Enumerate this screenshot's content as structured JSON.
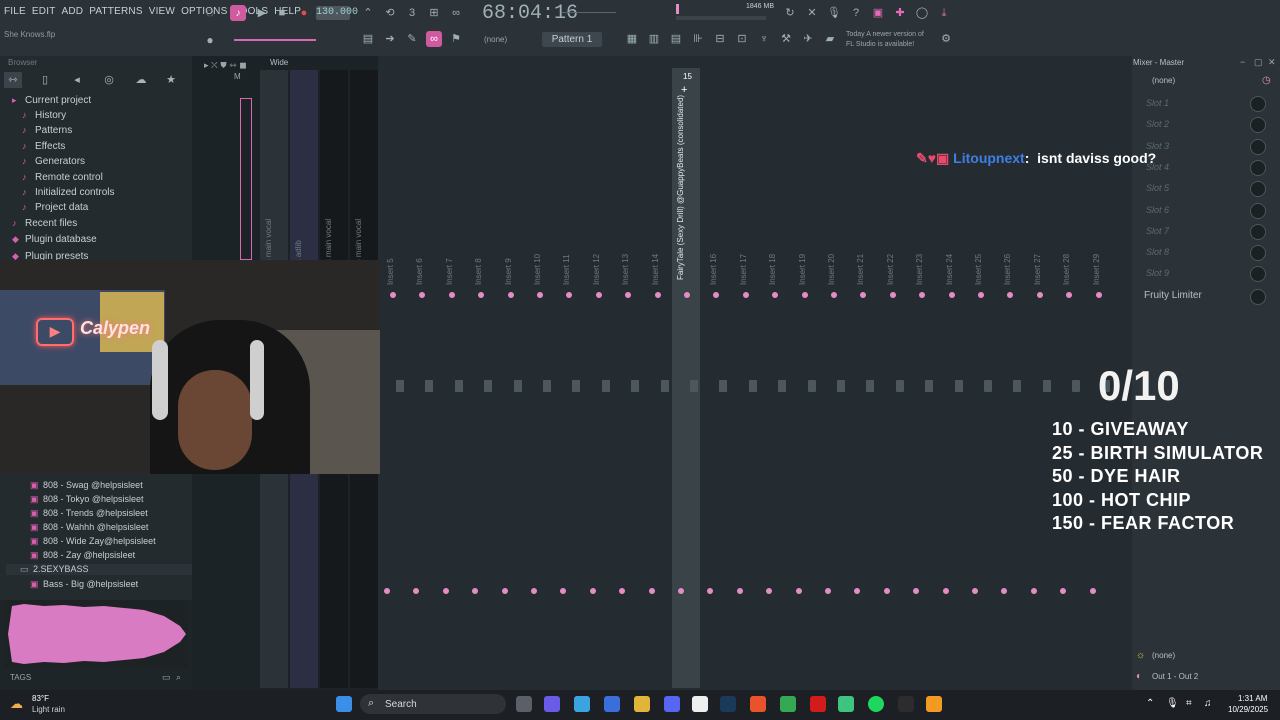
{
  "menu": [
    "FILE",
    "EDIT",
    "ADD",
    "PATTERNS",
    "VIEW",
    "OPTIONS",
    "TOOLS",
    "HELP"
  ],
  "project": {
    "song_name": "She Knows.flp",
    "tempo": "130.000",
    "time": "68:04:16",
    "pattern": "Pattern 1",
    "pattern_none": "(none)"
  },
  "memory": "1846 MB",
  "news": [
    "Today  A newer version of",
    "FL Studio is available!"
  ],
  "browser": {
    "title": "Browser",
    "items": [
      {
        "label": "Current project",
        "icon": "▸"
      },
      {
        "label": "History",
        "icon": "♪"
      },
      {
        "label": "Patterns",
        "icon": "♪"
      },
      {
        "label": "Effects",
        "icon": "♪"
      },
      {
        "label": "Generators",
        "icon": "♪"
      },
      {
        "label": "Remote control",
        "icon": "♪"
      },
      {
        "label": "Initialized controls",
        "icon": "♪"
      },
      {
        "label": "Project data",
        "icon": "♪"
      },
      {
        "label": "Recent files",
        "icon": "♪"
      },
      {
        "label": "Plugin database",
        "icon": "◆"
      },
      {
        "label": "Plugin presets",
        "icon": "◆"
      }
    ],
    "lower_items": [
      "808 - Swag @helpsisleet",
      "808 - Tokyo @helpsisleet",
      "808 - Trends @helpsisleet",
      "808 - Wahhh @helpsisleet",
      "808 - Wide Zay@helpsisleet",
      "808 - Zay @helpsisleet",
      "2.SEXYBASS",
      "Bass - Big @helpsisleet"
    ],
    "tags_label": "TAGS"
  },
  "rack": {
    "view_label": "Wide",
    "master_label": "M",
    "columns": [
      "1",
      "2",
      "3",
      "4"
    ],
    "track_names": [
      "um's main vocal",
      "um's adlib",
      "um's main vocal",
      "um's main vocal"
    ]
  },
  "mixer": {
    "title": "Mixer - Master",
    "selected_insert": "15",
    "selected_name": "FairyTale (Sexy Drill) @GuappyBeats (consolidated)",
    "inserts": [
      "Insert 5",
      "Insert 6",
      "Insert 7",
      "Insert 8",
      "Insert 9",
      "Insert 10",
      "Insert 11",
      "Insert 12",
      "Insert 13",
      "Insert 14",
      "",
      "Insert 16",
      "Insert 17",
      "Insert 18",
      "Insert 19",
      "Insert 20",
      "Insert 21",
      "Insert 22",
      "Insert 23",
      "Insert 24",
      "Insert 25",
      "Insert 26",
      "Insert 27",
      "Insert 28",
      "Insert 29"
    ],
    "none_top": "(none)",
    "slots": [
      "Slot 1",
      "Slot 2",
      "Slot 3",
      "Slot 4",
      "Slot 5",
      "Slot 6",
      "Slot 7",
      "Slot 8",
      "Slot 9"
    ],
    "limiter": "Fruity Limiter",
    "none_bottom": "(none)",
    "output": "Out 1 - Out 2"
  },
  "overlay": {
    "chat_user": "Litoupnext",
    "chat_sep": ":",
    "chat_message": "isnt daviss good?",
    "counter": "0/10",
    "goals": [
      "10 - GIVEAWAY",
      "25 - BIRTH SIMULATOR",
      "50 - DYE HAIR",
      "100 - HOT CHIP",
      "150 - FEAR FACTOR"
    ]
  },
  "webcam": {
    "sign_text": "Calypen"
  },
  "taskbar": {
    "temp": "83°F",
    "condition": "Light rain",
    "search": "Search",
    "time": "1:31 AM",
    "date": "10/29/2025"
  },
  "colors": {
    "accent": "#e58cc4",
    "chat_user": "#3e7fe6"
  }
}
